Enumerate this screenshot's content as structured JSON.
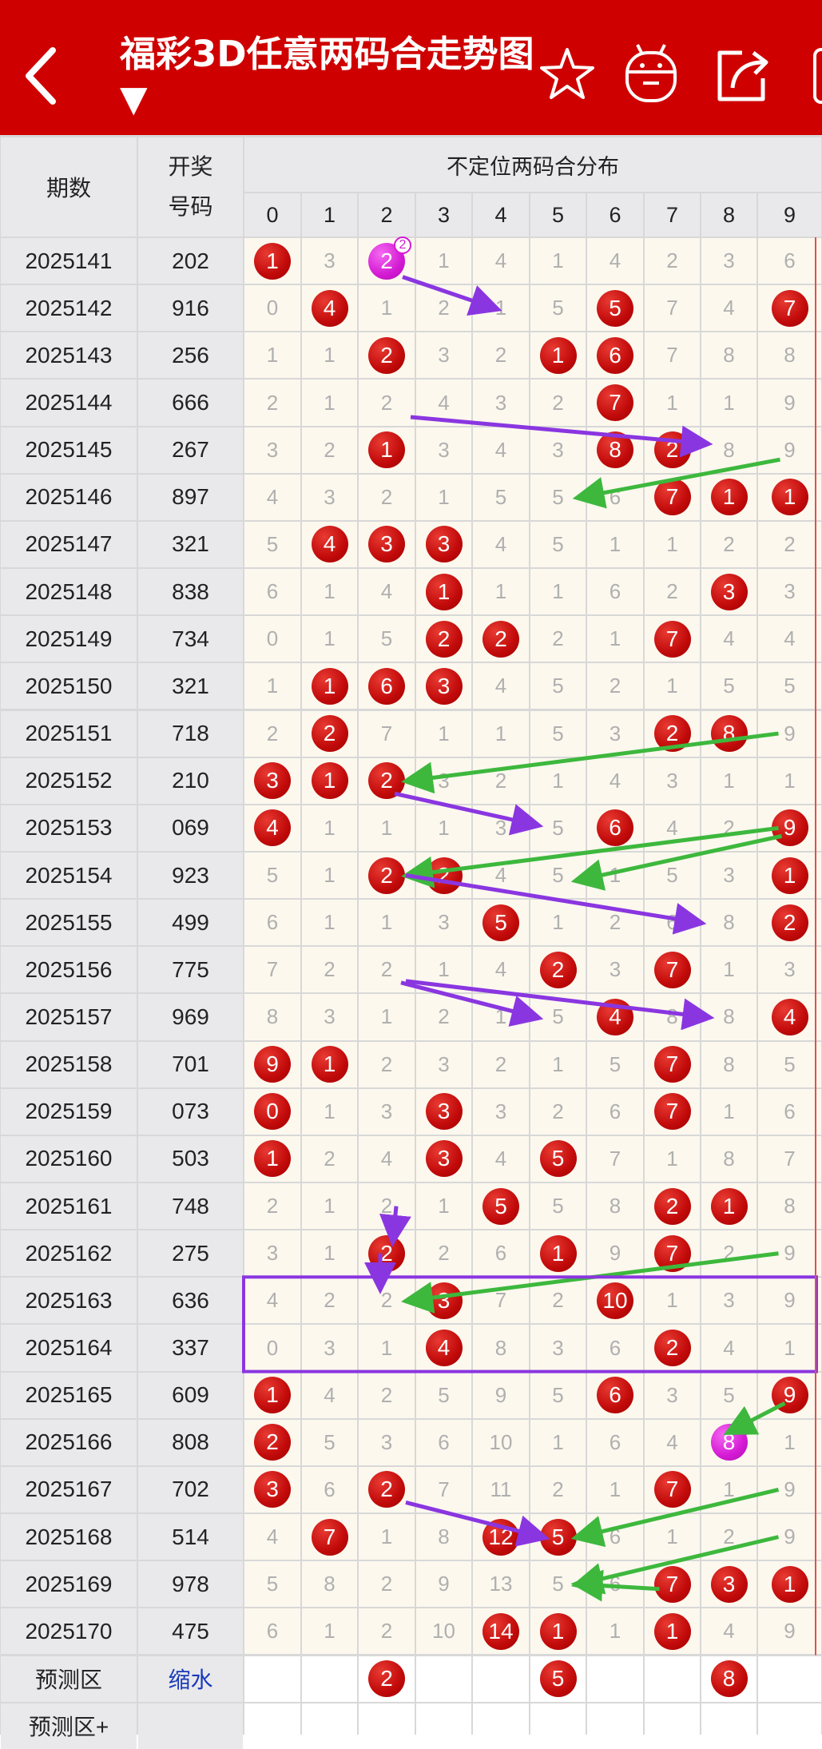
{
  "header": {
    "title": "福彩3D任意两码合走势图 ▼",
    "back_icon": "back-arrow-icon",
    "star_icon": "star-icon",
    "robot_icon": "robot-icon",
    "share_icon": "share-icon"
  },
  "table": {
    "col_period": "期数",
    "col_draw": "开奖号码",
    "col_dist": "不定位两码合分布",
    "digits": [
      "0",
      "1",
      "2",
      "3",
      "4",
      "5",
      "6",
      "7",
      "8",
      "9"
    ],
    "rows": [
      {
        "period": "2025141",
        "draw": "202",
        "cells": [
          "1",
          "3",
          "2",
          "1",
          "4",
          "1",
          "4",
          "2",
          "3",
          "6"
        ]
      },
      {
        "period": "2025142",
        "draw": "916",
        "cells": [
          "0",
          "4",
          "1",
          "2",
          "1",
          "5",
          "5",
          "7",
          "4",
          "7"
        ]
      },
      {
        "period": "2025143",
        "draw": "256",
        "cells": [
          "1",
          "1",
          "2",
          "3",
          "2",
          "1",
          "6",
          "7",
          "8",
          "8"
        ]
      },
      {
        "period": "2025144",
        "draw": "666",
        "cells": [
          "2",
          "1",
          "2",
          "4",
          "3",
          "2",
          "7",
          "1",
          "1",
          "9"
        ]
      },
      {
        "period": "2025145",
        "draw": "267",
        "cells": [
          "3",
          "2",
          "1",
          "3",
          "4",
          "3",
          "8",
          "2",
          "8",
          "9"
        ]
      },
      {
        "period": "2025146",
        "draw": "897",
        "cells": [
          "4",
          "3",
          "2",
          "1",
          "5",
          "5",
          "6",
          "7",
          "1",
          "1"
        ]
      },
      {
        "period": "2025147",
        "draw": "321",
        "cells": [
          "5",
          "4",
          "3",
          "3",
          "4",
          "5",
          "1",
          "1",
          "2",
          "2"
        ]
      },
      {
        "period": "2025148",
        "draw": "838",
        "cells": [
          "6",
          "1",
          "4",
          "1",
          "1",
          "1",
          "6",
          "2",
          "3",
          "3"
        ]
      },
      {
        "period": "2025149",
        "draw": "734",
        "cells": [
          "0",
          "1",
          "5",
          "2",
          "2",
          "2",
          "1",
          "7",
          "4",
          "4"
        ]
      },
      {
        "period": "2025150",
        "draw": "321",
        "cells": [
          "1",
          "1",
          "6",
          "3",
          "4",
          "5",
          "2",
          "1",
          "5",
          "5"
        ]
      },
      {
        "period": "2025151",
        "draw": "718",
        "cells": [
          "2",
          "2",
          "7",
          "1",
          "1",
          "5",
          "3",
          "2",
          "8",
          "9"
        ]
      },
      {
        "period": "2025152",
        "draw": "210",
        "cells": [
          "3",
          "1",
          "2",
          "3",
          "2",
          "1",
          "4",
          "3",
          "1",
          "1"
        ]
      },
      {
        "period": "2025153",
        "draw": "069",
        "cells": [
          "4",
          "1",
          "1",
          "1",
          "3",
          "5",
          "6",
          "4",
          "2",
          "9"
        ]
      },
      {
        "period": "2025154",
        "draw": "923",
        "cells": [
          "5",
          "1",
          "2",
          "2",
          "4",
          "5",
          "1",
          "5",
          "3",
          "1"
        ]
      },
      {
        "period": "2025155",
        "draw": "499",
        "cells": [
          "6",
          "1",
          "1",
          "3",
          "5",
          "1",
          "2",
          "6",
          "8",
          "2"
        ]
      },
      {
        "period": "2025156",
        "draw": "775",
        "cells": [
          "7",
          "2",
          "2",
          "1",
          "4",
          "2",
          "3",
          "7",
          "1",
          "3"
        ]
      },
      {
        "period": "2025157",
        "draw": "969",
        "cells": [
          "8",
          "3",
          "1",
          "2",
          "1",
          "5",
          "4",
          "8",
          "8",
          "4"
        ]
      },
      {
        "period": "2025158",
        "draw": "701",
        "cells": [
          "9",
          "1",
          "2",
          "3",
          "2",
          "1",
          "5",
          "7",
          "8",
          "5"
        ]
      },
      {
        "period": "2025159",
        "draw": "073",
        "cells": [
          "0",
          "1",
          "3",
          "3",
          "3",
          "2",
          "6",
          "7",
          "1",
          "6"
        ]
      },
      {
        "period": "2025160",
        "draw": "503",
        "cells": [
          "1",
          "2",
          "4",
          "3",
          "4",
          "5",
          "7",
          "1",
          "8",
          "7"
        ]
      },
      {
        "period": "2025161",
        "draw": "748",
        "cells": [
          "2",
          "1",
          "2",
          "1",
          "5",
          "5",
          "8",
          "2",
          "1",
          "8"
        ]
      },
      {
        "period": "2025162",
        "draw": "275",
        "cells": [
          "3",
          "1",
          "2",
          "2",
          "6",
          "1",
          "9",
          "7",
          "2",
          "9"
        ]
      },
      {
        "period": "2025163",
        "draw": "636",
        "cells": [
          "4",
          "2",
          "2",
          "3",
          "7",
          "2",
          "10",
          "1",
          "3",
          "9"
        ]
      },
      {
        "period": "2025164",
        "draw": "337",
        "cells": [
          "0",
          "3",
          "1",
          "4",
          "8",
          "3",
          "6",
          "2",
          "4",
          "1"
        ]
      },
      {
        "period": "2025165",
        "draw": "609",
        "cells": [
          "1",
          "4",
          "2",
          "5",
          "9",
          "5",
          "6",
          "3",
          "5",
          "9"
        ]
      },
      {
        "period": "2025166",
        "draw": "808",
        "cells": [
          "2",
          "5",
          "3",
          "6",
          "10",
          "1",
          "6",
          "4",
          "8",
          "1"
        ]
      },
      {
        "period": "2025167",
        "draw": "702",
        "cells": [
          "3",
          "6",
          "2",
          "7",
          "11",
          "2",
          "1",
          "7",
          "1",
          "9"
        ]
      },
      {
        "period": "2025168",
        "draw": "514",
        "cells": [
          "4",
          "7",
          "1",
          "8",
          "12",
          "5",
          "6",
          "1",
          "2",
          "9"
        ]
      },
      {
        "period": "2025169",
        "draw": "978",
        "cells": [
          "5",
          "8",
          "2",
          "9",
          "13",
          "5",
          "6",
          "7",
          "3",
          "1"
        ]
      },
      {
        "period": "2025170",
        "draw": "475",
        "cells": [
          "6",
          "1",
          "2",
          "10",
          "14",
          "1",
          "1",
          "1",
          "4",
          "9"
        ]
      }
    ],
    "predict": {
      "label": "预测区",
      "ctrl": "缩水",
      "balls": [
        "2",
        "5",
        "8"
      ]
    },
    "predict_plus": {
      "label": "预测区+"
    }
  },
  "colors": {
    "header": "#cf0000",
    "ball_red": "#c10a0a",
    "ball_magenta": "#d41ad4",
    "ball_purple": "#8212a8",
    "arrow_purple": "#8a36e0",
    "arrow_green": "#3db83d",
    "highlight_box": "#8a36e0"
  }
}
